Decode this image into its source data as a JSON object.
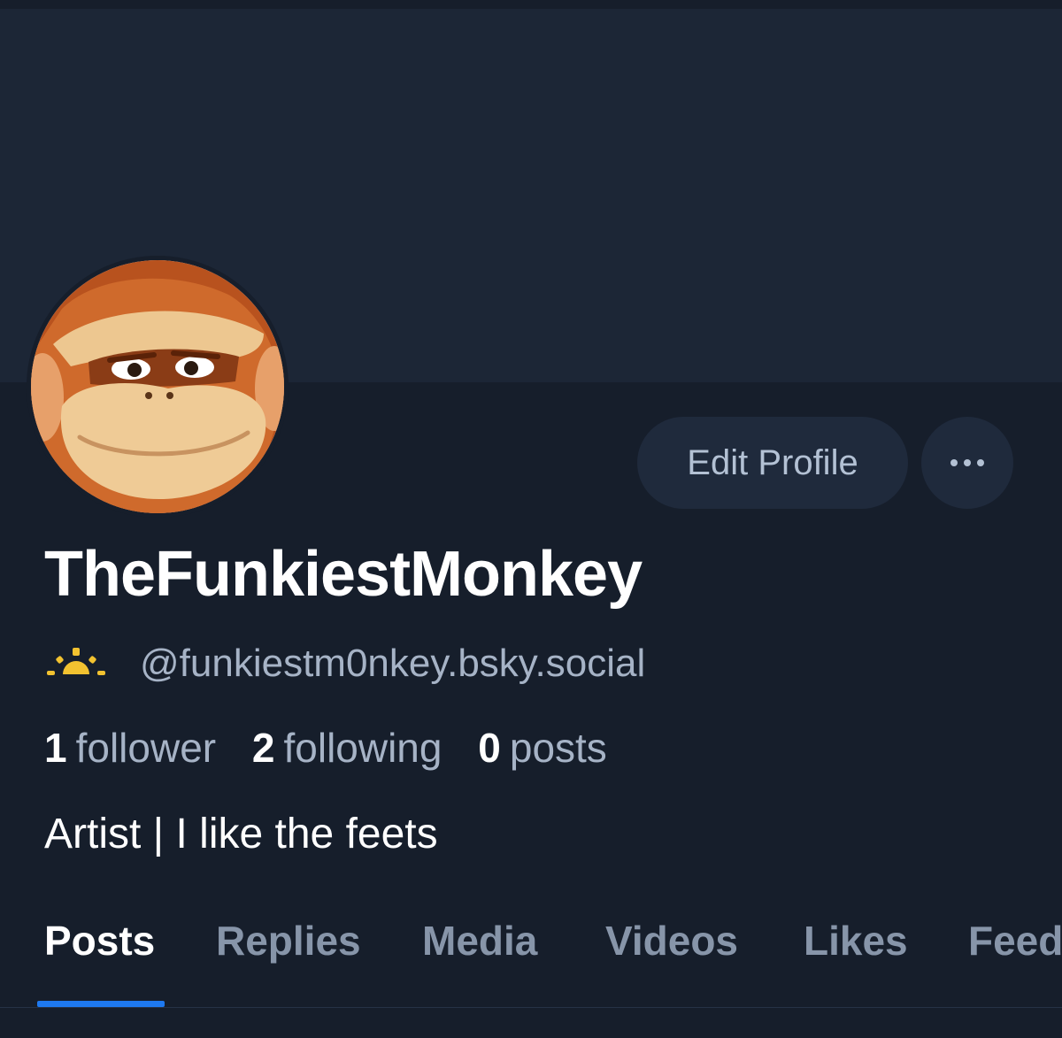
{
  "profile": {
    "display_name": "TheFunkiestMonkey",
    "handle": "@funkiestm0nkey.bsky.social",
    "handle_icon": "sunrise-icon",
    "bio": "Artist | I like the feets"
  },
  "stats": {
    "followers_count": "1",
    "followers_label": "follower",
    "following_count": "2",
    "following_label": "following",
    "posts_count": "0",
    "posts_label": "posts"
  },
  "actions": {
    "edit_profile_label": "Edit Profile",
    "more_icon": "ellipsis-icon"
  },
  "tabs": [
    {
      "label": "Posts",
      "active": true
    },
    {
      "label": "Replies",
      "active": false
    },
    {
      "label": "Media",
      "active": false
    },
    {
      "label": "Videos",
      "active": false
    },
    {
      "label": "Likes",
      "active": false
    },
    {
      "label": "Feeds",
      "active": false
    }
  ],
  "colors": {
    "background": "#161e2b",
    "banner": "#1c2636",
    "button_bg": "#1f2a3c",
    "secondary_text": "#a6b3c6",
    "accent": "#1e79f0",
    "sun_icon": "#f2c230"
  }
}
